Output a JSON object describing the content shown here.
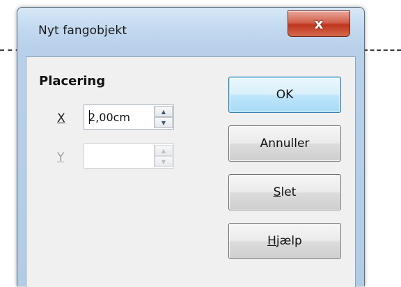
{
  "dialog": {
    "title": "Nyt fangobjekt",
    "close_glyph": "x"
  },
  "position_section": {
    "title": "Placering",
    "x_label": "X",
    "x_value": "2,00cm",
    "y_label": "Y",
    "y_value": ""
  },
  "buttons": {
    "ok": "OK",
    "cancel": "Annuller",
    "delete_first": "S",
    "delete_rest": "let",
    "help_first": "H",
    "help_rest": "jælp"
  },
  "icons": {
    "spin_up": "▲",
    "spin_down": "▼"
  },
  "colors": {
    "title_bar": "#c3d9ef",
    "close_button": "#c0351e",
    "default_button": "#bee6fd"
  }
}
